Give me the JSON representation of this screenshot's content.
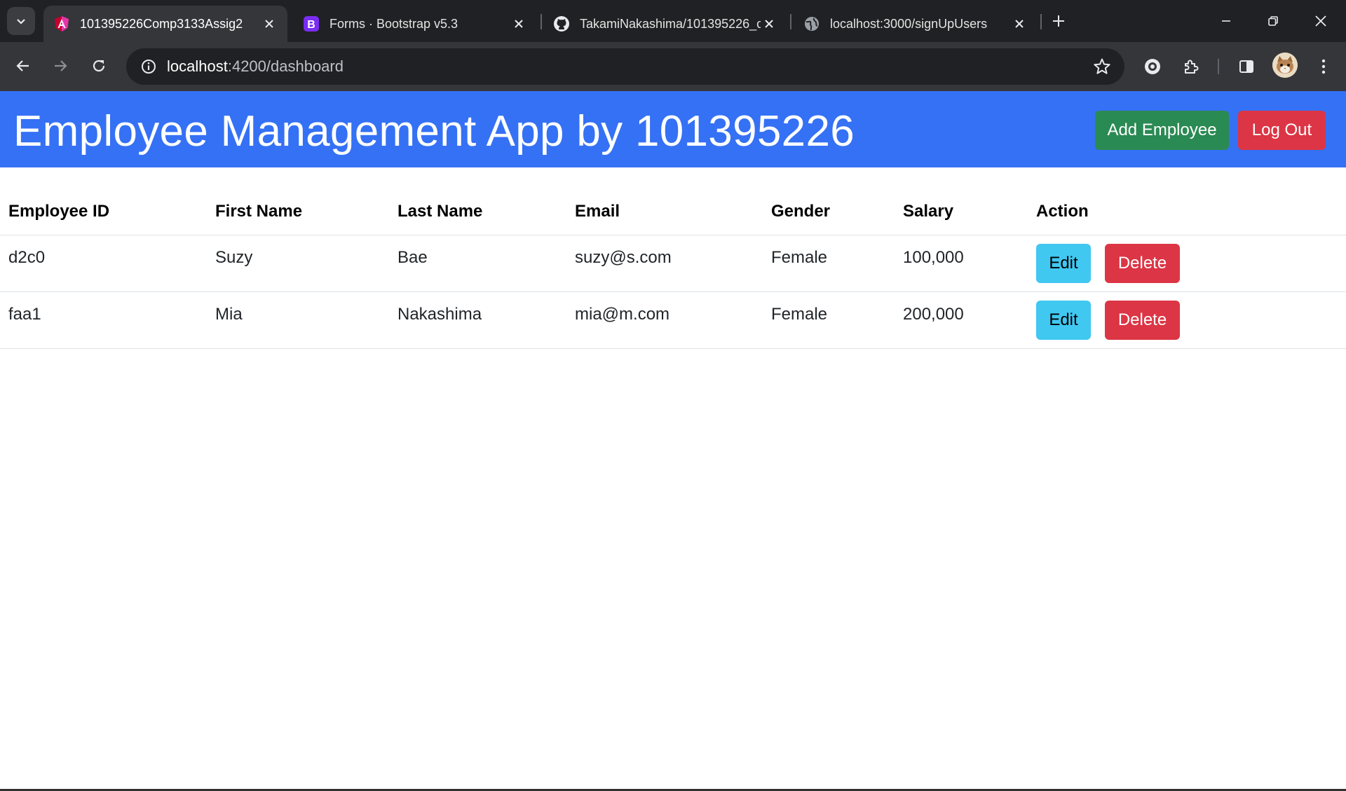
{
  "browser": {
    "tabs": [
      {
        "title": "101395226Comp3133Assig2",
        "icon": "angular-icon",
        "active": true
      },
      {
        "title": "Forms · Bootstrap v5.3",
        "icon": "bootstrap-icon",
        "active": false
      },
      {
        "title": "TakamiNakashima/101395226_c",
        "icon": "github-icon",
        "active": false
      },
      {
        "title": "localhost:3000/signUpUsers",
        "icon": "globe-icon",
        "active": false
      }
    ],
    "url_host": "localhost",
    "url_path": ":4200/dashboard"
  },
  "app": {
    "title": "Employee Management App by 101395226",
    "add_button": "Add Employee",
    "logout_button": "Log Out",
    "header_color": "#3571f5"
  },
  "table": {
    "headers": [
      "Employee ID",
      "First Name",
      "Last Name",
      "Email",
      "Gender",
      "Salary",
      "Action"
    ],
    "rows": [
      {
        "id": "d2c0",
        "first": "Suzy",
        "last": "Bae",
        "email": "suzy@s.com",
        "gender": "Female",
        "salary": "100,000",
        "edit": "Edit",
        "delete": "Delete"
      },
      {
        "id": "faa1",
        "first": "Mia",
        "last": "Nakashima",
        "email": "mia@m.com",
        "gender": "Female",
        "salary": "200,000",
        "edit": "Edit",
        "delete": "Delete"
      }
    ]
  }
}
